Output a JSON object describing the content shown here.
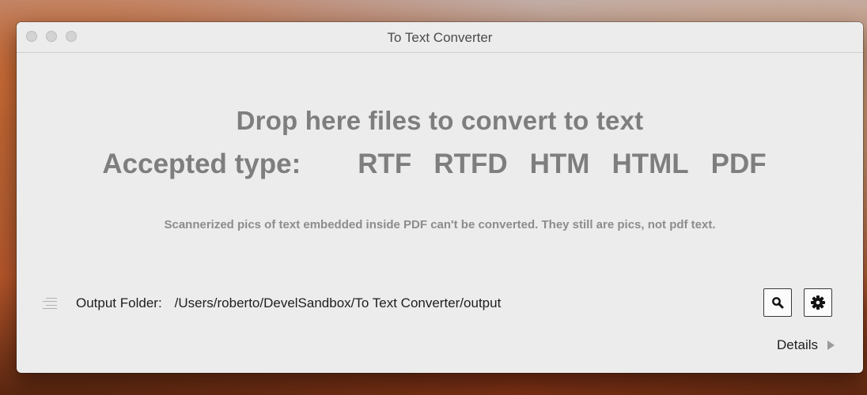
{
  "window": {
    "title": "To Text Converter"
  },
  "main": {
    "headline": "Drop here files to convert to text",
    "accepted_label": "Accepted type:",
    "accepted_types": [
      "RTF",
      "RTFD",
      "HTM",
      "HTML",
      "PDF"
    ],
    "note": "Scannerized pics of text embedded inside PDF can't be converted. They still are pics, not pdf text."
  },
  "output": {
    "label": "Output Folder:",
    "path": "/Users/roberto/DevelSandbox/To Text Converter/output",
    "icon": "list-icon"
  },
  "toolbar": {
    "search_icon": "search-icon",
    "settings_icon": "gear-icon"
  },
  "details": {
    "label": "Details",
    "icon": "disclosure-triangle-icon"
  }
}
